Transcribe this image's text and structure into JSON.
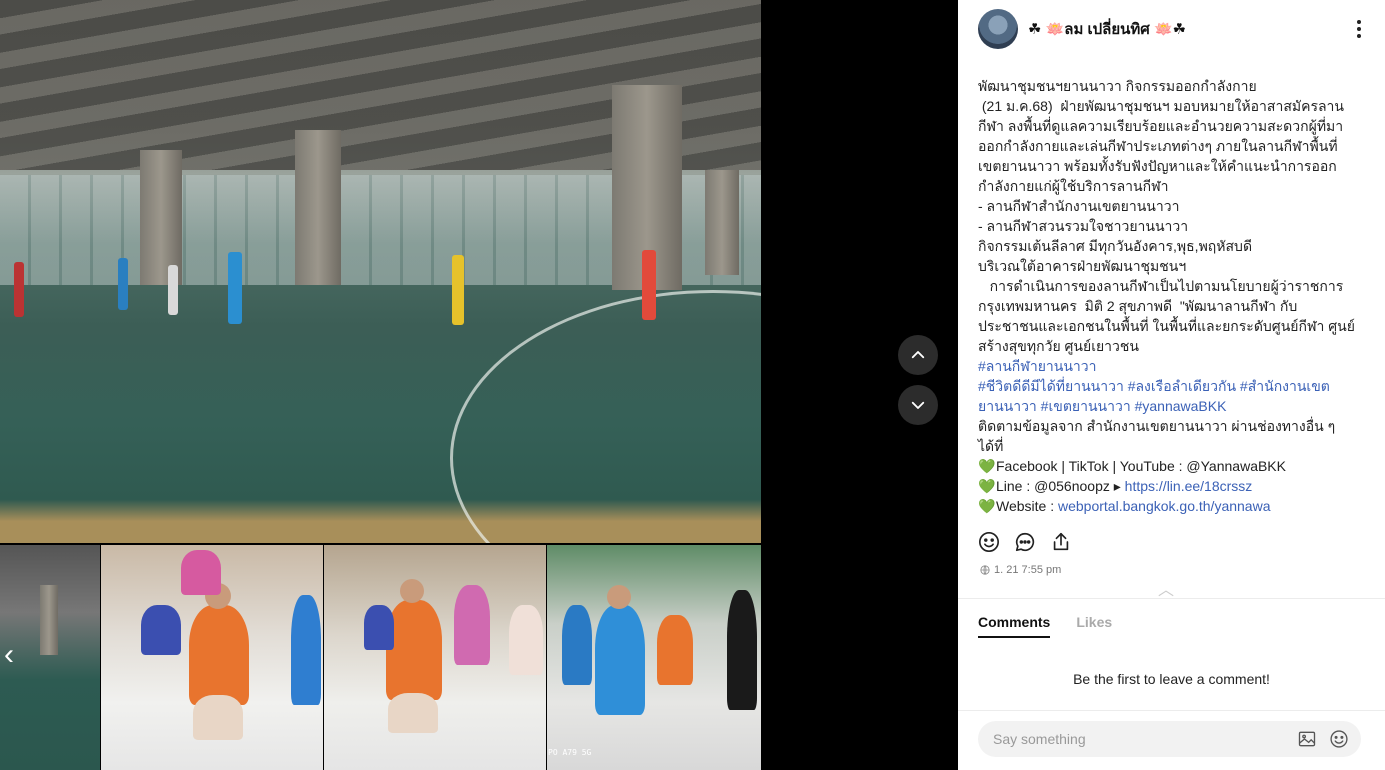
{
  "post": {
    "username": "☘︎ 🪷ลม เปลี่ยนทิศ 🪷☘︎",
    "caption": {
      "line1": "พัฒนาชุมชนฯยานนาวา กิจกรรมออกกำลังกาย",
      "line2": " (21 ม.ค.68)  ฝ่ายพัฒนาชุมชนฯ มอบหมายให้อาสาสมัครลาน",
      "line3": "กีฬา ลงพื้นที่ดูแลความเรียบร้อยและอำนวยความสะดวกผู้ที่มา",
      "line4": "ออกกำลังกายและเล่นกีฬาประเภทต่างๆ ภายในลานกีฬาพื้นที่",
      "line5": "เขตยานนาวา พร้อมทั้งรับฟังปัญหาและให้คำแนะนำการออก",
      "line6": "กำลังกายแก่ผู้ใช้บริการลานกีฬา",
      "line7": "- ลานกีฬาสำนักงานเขตยานนาวา",
      "line8": "- ลานกีฬาสวนรวมใจชาวยานนาวา",
      "line9": "กิจกรรมเต้นลีลาศ มีทุกวันอังคาร,พุธ,พฤหัสบดี",
      "line10": "บริเวณใต้อาคารฝ่ายพัฒนาชุมชนฯ",
      "line11": "   การดำเนินการของลานกีฬาเป็นไปตามนโยบายผู้ว่าราชการ",
      "line12": "กรุงเทพมหานคร  มิติ 2 สุขภาพดี  \"พัฒนาลานกีฬา กับ",
      "line13": "ประชาชนและเอกชนในพื้นที่ ในพื้นที่และยกระดับศูนย์กีฬา ศูนย์",
      "line14": "สร้างสุขทุกวัย ศูนย์เยาวชน",
      "hashtag1": "#ลานกีฬายานนาวา",
      "hashtag2a": "#ชีวิตดีดีมีได้ที่ยานนาวา #ลงเรือลำเดียวกัน #สำนักงานเขต",
      "hashtag2b": "ยานนาวา #เขตยานนาวา #yannawaBKK",
      "follow1": "ติดตามข้อมูลจาก สำนักงานเขตยานนาวา ผ่านช่องทางอื่น ๆ",
      "follow2": "ได้ที่",
      "heart": "💚",
      "social": "Facebook | TikTok | YouTube : @YannawaBKK",
      "line_label": "Line : @056noopz ▸ ",
      "line_link": "https://lin.ee/18crssz",
      "web_label": "Website : ",
      "web_link": "webportal.bangkok.go.th/yannawa"
    },
    "timestamp": "1. 21 7:55 pm"
  },
  "media": {
    "camera_label": "PO A79 5G"
  },
  "comments": {
    "tab_comments": "Comments",
    "tab_likes": "Likes",
    "empty_text": "Be the first to leave a comment!",
    "input_placeholder": "Say something"
  },
  "icons": {
    "more": "more-vertical-icon",
    "nav_up": "chevron-up-icon",
    "nav_down": "chevron-down-icon",
    "thumb_prev": "chevron-left-icon",
    "like": "smile-icon",
    "comment": "comment-icon",
    "share": "share-icon",
    "globe": "globe-icon",
    "image": "image-icon",
    "emoji": "emoji-icon"
  }
}
